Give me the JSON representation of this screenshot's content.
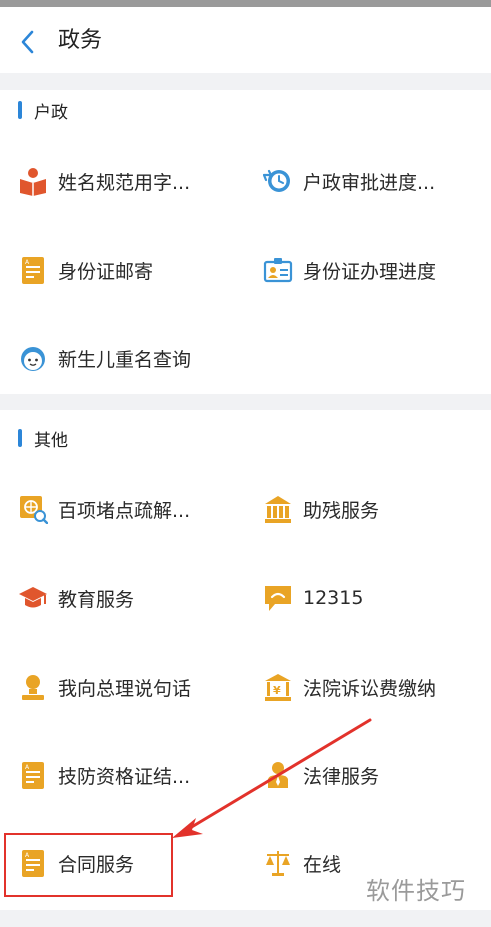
{
  "header": {
    "title": "政务"
  },
  "sections": [
    {
      "title": "户政",
      "items": [
        {
          "label": "姓名规范用字...",
          "icon": "reading-book-icon"
        },
        {
          "label": "户政审批进度...",
          "icon": "clock-progress-icon"
        },
        {
          "label": "身份证邮寄",
          "icon": "document-icon"
        },
        {
          "label": "身份证办理进度",
          "icon": "id-card-icon"
        },
        {
          "label": "新生儿重名查询",
          "icon": "baby-face-icon"
        }
      ]
    },
    {
      "title": "其他",
      "items": [
        {
          "label": "百项堵点疏解...",
          "icon": "globe-search-icon"
        },
        {
          "label": "助残服务",
          "icon": "building-icon"
        },
        {
          "label": "教育服务",
          "icon": "graduation-cap-icon"
        },
        {
          "label": "12315",
          "icon": "chat-bubble-icon"
        },
        {
          "label": "我向总理说句话",
          "icon": "person-speak-icon"
        },
        {
          "label": "法院诉讼费缴纳",
          "icon": "court-fee-icon"
        },
        {
          "label": "技防资格证结...",
          "icon": "document-icon"
        },
        {
          "label": "法律服务",
          "icon": "lawyer-icon"
        },
        {
          "label": "合同服务",
          "icon": "document-icon"
        },
        {
          "label": "在线",
          "icon": "scales-icon"
        }
      ]
    }
  ],
  "watermark": "软件技巧",
  "colors": {
    "accent_blue": "#2c86d8",
    "icon_orange": "#e9a425",
    "icon_red": "#e0562d",
    "highlight_red": "#e2322b"
  }
}
